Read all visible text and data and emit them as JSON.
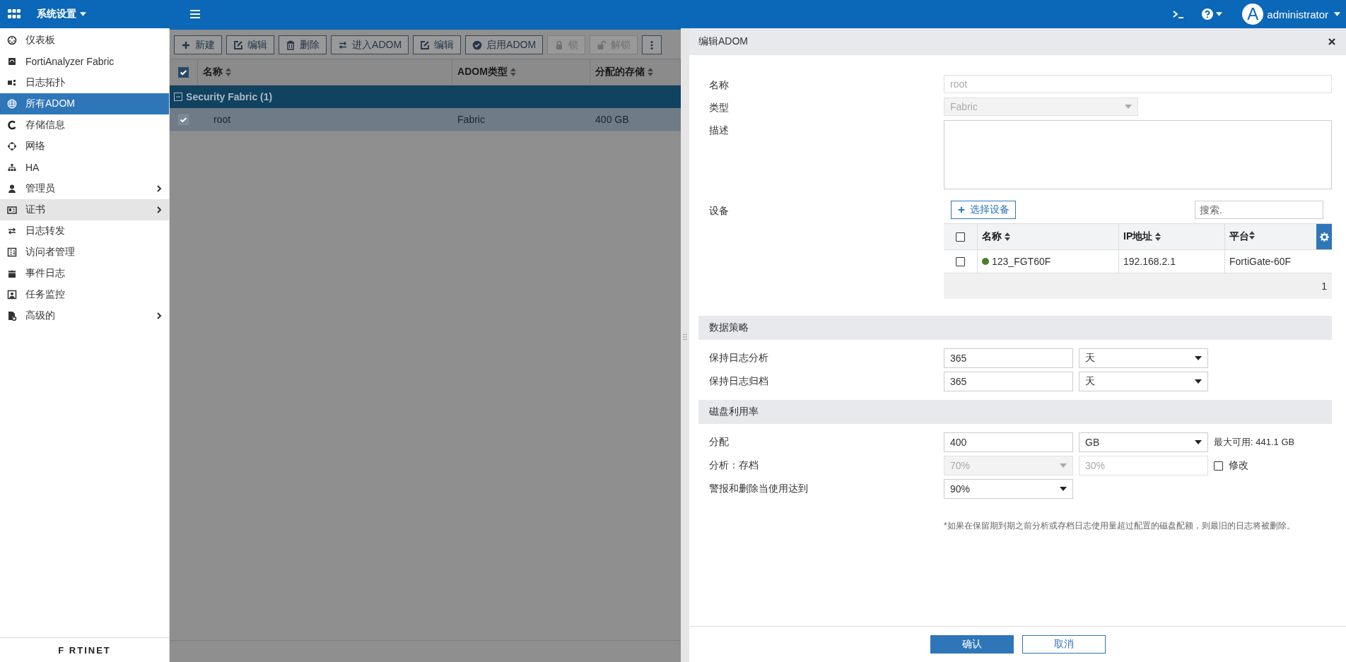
{
  "top_bar": {
    "menu_title": "系统设置",
    "avatar_letter": "A",
    "user": "administrator"
  },
  "sidebar": {
    "items": [
      {
        "label": "仪表板",
        "kind": "dial",
        "selected": false,
        "highlighted": false,
        "submenu": false
      },
      {
        "label": "FortiAnalyzer Fabric",
        "kind": "device",
        "selected": false,
        "highlighted": false,
        "submenu": false
      },
      {
        "label": "日志拓扑",
        "kind": "blocks",
        "selected": false,
        "highlighted": false,
        "submenu": false
      },
      {
        "label": "所有ADOM",
        "kind": "globe",
        "selected": true,
        "highlighted": false,
        "submenu": false
      },
      {
        "label": "存储信息",
        "kind": "ring",
        "selected": false,
        "highlighted": false,
        "submenu": false
      },
      {
        "label": "网络",
        "kind": "dots",
        "selected": false,
        "highlighted": false,
        "submenu": false
      },
      {
        "label": "HA",
        "kind": "tree",
        "selected": false,
        "highlighted": false,
        "submenu": false
      },
      {
        "label": "管理员",
        "kind": "person",
        "selected": false,
        "highlighted": false,
        "submenu": true
      },
      {
        "label": "证书",
        "kind": "card",
        "selected": false,
        "highlighted": true,
        "submenu": true
      },
      {
        "label": "日志转发",
        "kind": "arrows",
        "selected": false,
        "highlighted": false,
        "submenu": false
      },
      {
        "label": "访问者管理",
        "kind": "listbox",
        "selected": false,
        "highlighted": false,
        "submenu": false
      },
      {
        "label": "事件日志",
        "kind": "calendar",
        "selected": false,
        "highlighted": false,
        "submenu": false
      },
      {
        "label": "任务监控",
        "kind": "monitor",
        "selected": false,
        "highlighted": false,
        "submenu": false
      },
      {
        "label": "高级的",
        "kind": "filegear",
        "selected": false,
        "highlighted": false,
        "submenu": true
      }
    ],
    "logo": "F RTINET"
  },
  "toolbar": {
    "buttons": [
      {
        "label": "新建",
        "kind": "plus",
        "disabled": false
      },
      {
        "label": "编辑",
        "kind": "edit",
        "disabled": false
      },
      {
        "label": "删除",
        "kind": "trash",
        "disabled": false
      },
      {
        "label": "进入ADOM",
        "kind": "swap",
        "disabled": false
      },
      {
        "label": "编辑",
        "kind": "edit",
        "disabled": false
      },
      {
        "label": "启用ADOM",
        "kind": "check",
        "disabled": false
      },
      {
        "label": "锁",
        "kind": "lock",
        "disabled": true
      },
      {
        "label": "解锁",
        "kind": "unlock",
        "disabled": true
      },
      {
        "kind": "more"
      }
    ]
  },
  "table": {
    "header_checked": true,
    "columns": [
      "名称",
      "ADOM类型",
      "分配的存储"
    ],
    "groups": [
      {
        "label": "Security Fabric (1)",
        "expanded": true,
        "rows": [
          {
            "checked": true,
            "cells": [
              "root",
              "Fabric",
              "400 GB"
            ]
          }
        ]
      }
    ]
  },
  "dialog": {
    "title": "编辑ADOM",
    "fields": [
      {
        "label": "名称",
        "kind": "text",
        "value": "root",
        "disabled": true
      },
      {
        "label": "类型",
        "kind": "select",
        "value": "Fabric",
        "disabled": true
      },
      {
        "label": "描述",
        "kind": "textarea"
      }
    ],
    "devices": {
      "label": "设备",
      "add_button": "选择设备",
      "search_placeholder": "搜索.",
      "header_checked": false,
      "columns": [
        "名称",
        "IP地址",
        "平台"
      ],
      "rows": [
        {
          "checked": false,
          "color": "#4e7d2a",
          "cells": [
            "123_FGT60F",
            "192.168.2.1",
            "FortiGate-60F"
          ]
        }
      ],
      "count": "1"
    },
    "sections": [
      {
        "title": "数据策略",
        "rows": [
          {
            "kind": "value-unit",
            "label": "保持日志分析",
            "value": "365",
            "unit": "天"
          },
          {
            "kind": "value-unit",
            "label": "保持日志归档",
            "value": "365",
            "unit": "天"
          }
        ]
      },
      {
        "title": "磁盘利用率",
        "rows": [
          {
            "kind": "value-unit",
            "label": "分配",
            "value": "400",
            "unit": "GB",
            "note": "最大可用: 441.1 GB"
          },
          {
            "kind": "ratio",
            "label": "分析：存档",
            "value": "70%",
            "second": "30%",
            "disabled": true,
            "checkbox": {
              "label": "修改",
              "checked": false
            }
          },
          {
            "kind": "select",
            "label": "警报和删除当使用达到",
            "value": "90%"
          }
        ]
      }
    ],
    "footnote": "*如果在保留期到期之前分析或存档日志使用量超过配置的磁盘配额，则最旧的日志将被删除。",
    "buttons": [
      {
        "label": "确认",
        "kind": "primary"
      },
      {
        "label": "取消",
        "kind": "secondary"
      }
    ]
  }
}
